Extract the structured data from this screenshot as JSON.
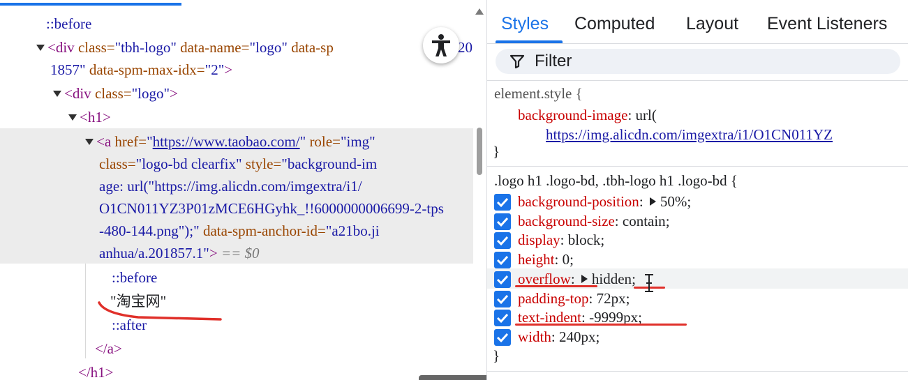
{
  "elements": {
    "before1": "::before",
    "div_tbh_open": "<div",
    "div_tbh_class_attr": "class=",
    "div_tbh_class_val": "\"tbh-logo\"",
    "div_tbh_name_attr": "data-name=",
    "div_tbh_name_val": "\"logo\"",
    "div_tbh_spm_attr": "data-sp",
    "div_tbh_spm_tail": "20",
    "div_tbh_line2_val": "1857\"",
    "div_tbh_maxidx_attr": "data-spm-max-idx=",
    "div_tbh_maxidx_val": "\"2\"",
    "div_tbh_close": ">",
    "div_logo_open": "<div",
    "div_logo_class_attr": "class=",
    "div_logo_class_val": "\"logo\"",
    "div_logo_close": ">",
    "h1_open": "<h1>",
    "a_open": "<a",
    "a_href_attr": "href=",
    "a_href_q1": "\"",
    "a_href_url": "https://www.taobao.com/",
    "a_href_q2": "\"",
    "a_role_attr": "role=",
    "a_role_val": "\"img\"",
    "a_line2_attr": "class=",
    "a_line2_val": "\"logo-bd clearfix\"",
    "a_line2_style_attr": "style=",
    "a_line2_style_val": "\"background-im",
    "a_line3": "age: url(\"https://img.alicdn.com/imgextra/i1/",
    "a_line4": "O1CN011YZ3P01zMCE6HGyhk_!!6000000006699-2-tps",
    "a_line5": "-480-144.png\");\"",
    "a_line5_anchor_attr": "data-spm-anchor-id=",
    "a_line5_anchor_val": "\"a21bo.ji",
    "a_line6_val": "anhua/a.201857.1\"",
    "a_line6_close": ">",
    "a_line6_eq": "== $0",
    "before2": "::before",
    "text_node": "\"淘宝网\"",
    "after": "::after",
    "a_close": "</a>",
    "h1_close": "</h1>"
  },
  "styles": {
    "tabs": [
      "Styles",
      "Computed",
      "Layout",
      "Event Listeners"
    ],
    "filter_placeholder": "Filter",
    "element_style_selector": "element.style {",
    "element_style_prop": "background-image",
    "element_style_val": "url(",
    "element_style_url": "https://img.alicdn.com/imgextra/i1/O1CN011YZ",
    "close_brace": "}",
    "rule_selector": ".logo h1 .logo-bd, .tbh-logo h1 .logo-bd {",
    "declarations": [
      {
        "prop": "background-position",
        "value": "50%",
        "expandable": true
      },
      {
        "prop": "background-size",
        "value": "contain",
        "expandable": false
      },
      {
        "prop": "display",
        "value": "block",
        "expandable": false
      },
      {
        "prop": "height",
        "value": "0",
        "expandable": false
      },
      {
        "prop": "overflow",
        "value": "hidden",
        "expandable": true
      },
      {
        "prop": "padding-top",
        "value": "72px",
        "expandable": false
      },
      {
        "prop": "text-indent",
        "value": "-9999px",
        "expandable": false
      },
      {
        "prop": "width",
        "value": "240px",
        "expandable": false
      }
    ]
  },
  "colors": {
    "accent": "#1a73e8",
    "annotation_red": "#e0302a",
    "tag": "#881280",
    "attr_name": "#994500",
    "attr_value": "#1a1aa6",
    "css_prop": "#c80000"
  },
  "icons": [
    "accessibility-icon",
    "filter-icon",
    "checkbox-checked-icon",
    "expand-triangle-icon",
    "scroll-up-arrow-icon",
    "text-cursor-icon"
  ]
}
